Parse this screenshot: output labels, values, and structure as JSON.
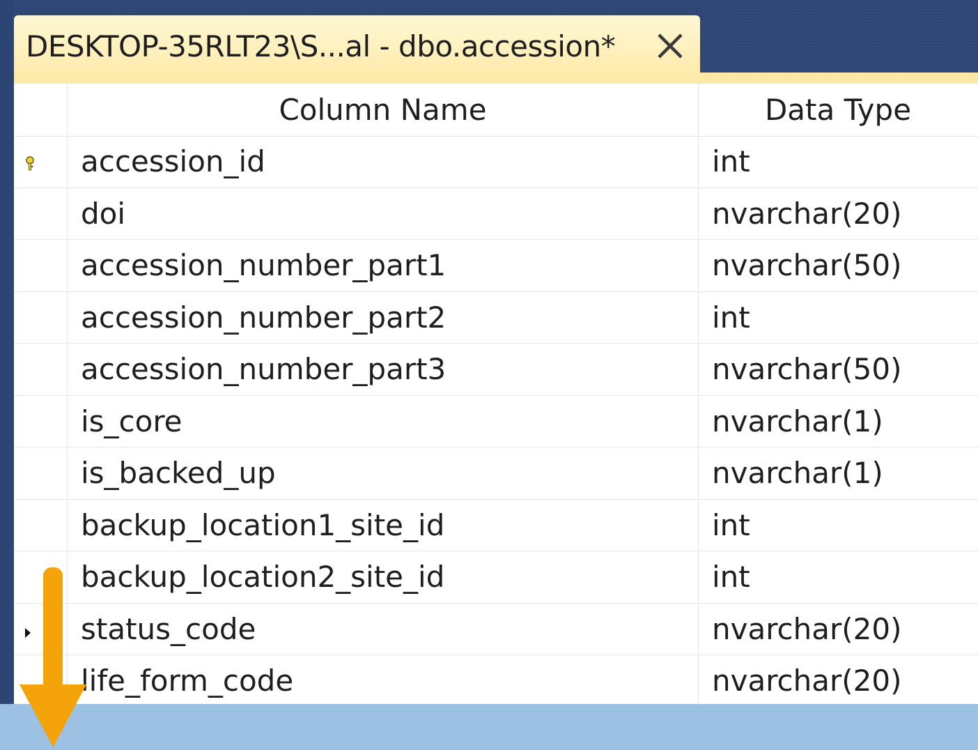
{
  "tab": {
    "title": "DESKTOP-35RLT23\\S...al - dbo.accession*",
    "close_icon": "close-icon"
  },
  "grid": {
    "headers": {
      "column_name": "Column Name",
      "data_type": "Data Type"
    },
    "rows": [
      {
        "name": "accession_id",
        "type": "int",
        "indicator": "primary-key-icon"
      },
      {
        "name": "doi",
        "type": "nvarchar(20)",
        "indicator": ""
      },
      {
        "name": "accession_number_part1",
        "type": "nvarchar(50)",
        "indicator": ""
      },
      {
        "name": "accession_number_part2",
        "type": "int",
        "indicator": ""
      },
      {
        "name": "accession_number_part3",
        "type": "nvarchar(50)",
        "indicator": ""
      },
      {
        "name": "is_core",
        "type": "nvarchar(1)",
        "indicator": ""
      },
      {
        "name": "is_backed_up",
        "type": "nvarchar(1)",
        "indicator": ""
      },
      {
        "name": "backup_location1_site_id",
        "type": "int",
        "indicator": ""
      },
      {
        "name": "backup_location2_site_id",
        "type": "int",
        "indicator": ""
      },
      {
        "name": "status_code",
        "type": "nvarchar(20)",
        "indicator": "current-row-icon"
      },
      {
        "name": "life_form_code",
        "type": "nvarchar(20)",
        "indicator": ""
      }
    ]
  },
  "annotation": {
    "arrow_icon": "down-arrow-icon",
    "arrow_color": "#f5a30a"
  },
  "colors": {
    "tab_background": "#fde9a5",
    "backdrop": "#2c4574",
    "bottom_band": "#9dc1e3"
  }
}
